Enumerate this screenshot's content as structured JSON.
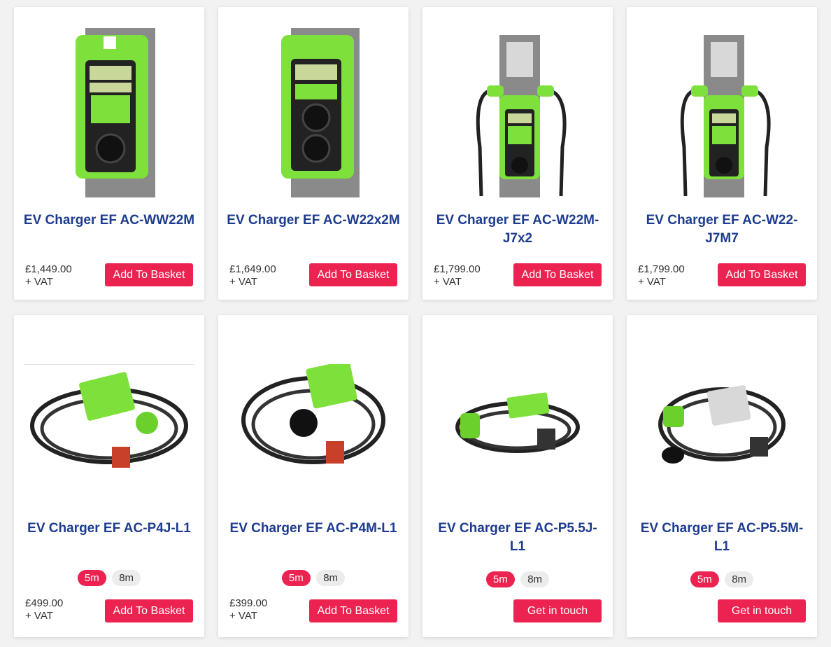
{
  "products": [
    {
      "title": "EV Charger EF AC-WW22M",
      "price": "£1,449.00",
      "vat": "+ VAT",
      "button": "Add To Basket"
    },
    {
      "title": "EV Charger EF AC-W22x2M",
      "price": "£1,649.00",
      "vat": "+ VAT",
      "button": "Add To Basket"
    },
    {
      "title": "EV Charger EF AC-W22M-J7x2",
      "price": "£1,799.00",
      "vat": "+ VAT",
      "button": "Add To Basket"
    },
    {
      "title": "EV Charger EF AC-W22-J7M7",
      "price": "£1,799.00",
      "vat": "+ VAT",
      "button": "Add To Basket"
    },
    {
      "title": "EV Charger EF AC-P4J-L1",
      "price": "£499.00",
      "vat": "+ VAT",
      "button": "Add To Basket",
      "options": [
        "5m",
        "8m"
      ],
      "selected": "5m"
    },
    {
      "title": "EV Charger EF AC-P4M-L1",
      "price": "£399.00",
      "vat": "+ VAT",
      "button": "Add To Basket",
      "options": [
        "5m",
        "8m"
      ],
      "selected": "5m"
    },
    {
      "title": "EV Charger EF AC-P5.5J-L1",
      "button": "Get in touch",
      "options": [
        "5m",
        "8m"
      ],
      "selected": "5m"
    },
    {
      "title": "EV Charger EF AC-P5.5M-L1",
      "button": "Get in touch",
      "options": [
        "5m",
        "8m"
      ],
      "selected": "5m"
    }
  ],
  "colors": {
    "accent": "#ec2350",
    "title": "#1d3c8f",
    "charger_green": "#7ee03a"
  },
  "icons": [
    "wall-charger-icon",
    "post-charger-icon",
    "portable-charger-icon"
  ]
}
